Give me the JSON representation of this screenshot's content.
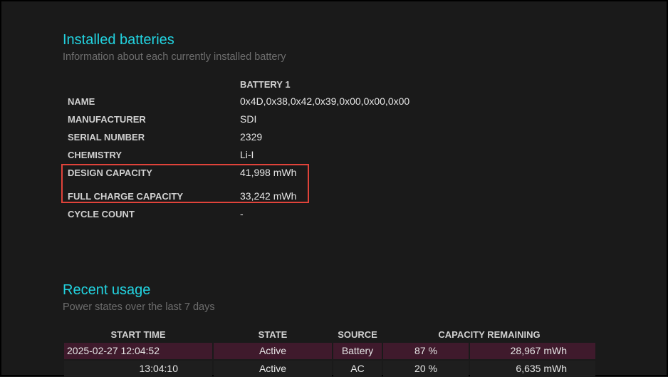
{
  "installed": {
    "title": "Installed batteries",
    "subtitle": "Information about each currently installed battery",
    "column": "BATTERY 1",
    "rows": [
      {
        "label": "NAME",
        "value": "0x4D,0x38,0x42,0x39,0x00,0x00,0x00"
      },
      {
        "label": "MANUFACTURER",
        "value": "SDI"
      },
      {
        "label": "SERIAL NUMBER",
        "value": "2329"
      },
      {
        "label": "CHEMISTRY",
        "value": "Li-I"
      },
      {
        "label": "DESIGN CAPACITY",
        "value": "41,998 mWh"
      },
      {
        "label": "FULL CHARGE CAPACITY",
        "value": "33,242 mWh"
      },
      {
        "label": "CYCLE COUNT",
        "value": "-"
      }
    ],
    "highlight_color": "#e0433a"
  },
  "recent": {
    "title": "Recent usage",
    "subtitle": "Power states over the last 7 days",
    "headers": [
      "START TIME",
      "STATE",
      "SOURCE",
      "CAPACITY REMAINING"
    ],
    "rows": [
      {
        "start": "2025-02-27  12:04:52",
        "state": "Active",
        "source": "Battery",
        "percent": "87 %",
        "mwh": "28,967 mWh"
      },
      {
        "start": "13:04:10",
        "state": "Active",
        "source": "AC",
        "percent": "20 %",
        "mwh": "6,635 mWh"
      }
    ]
  }
}
